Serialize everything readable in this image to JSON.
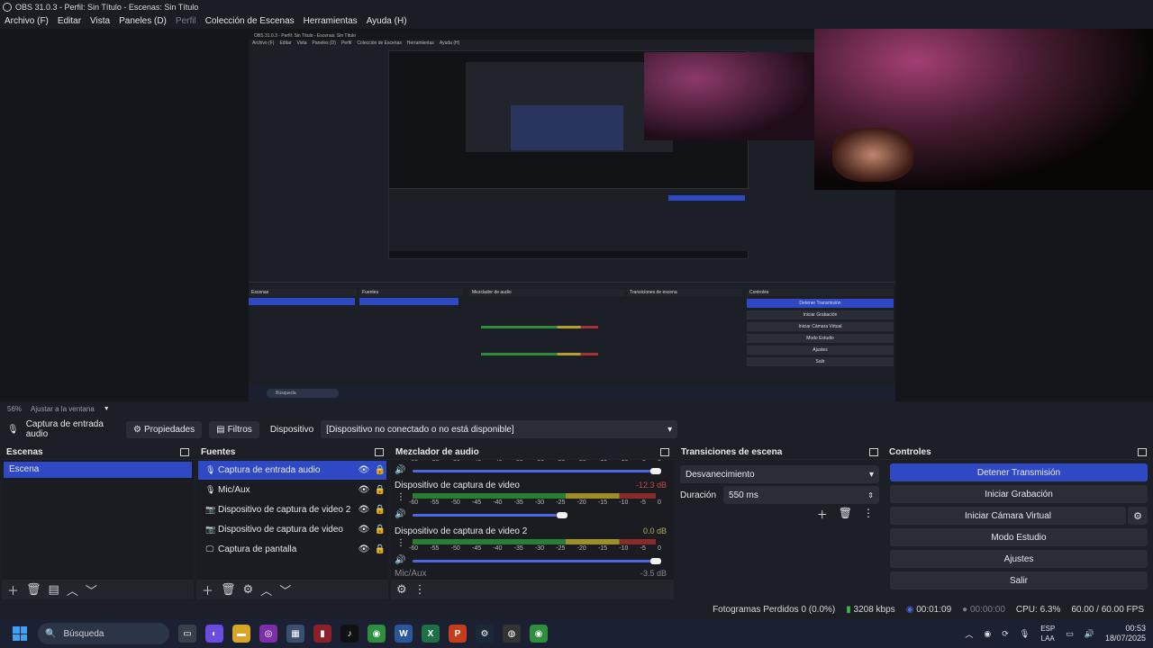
{
  "window": {
    "title": "OBS 31.0.3 - Perfil: Sin Título - Escenas: Sin Título"
  },
  "menu": [
    {
      "label": "Archivo (F)",
      "enabled": true
    },
    {
      "label": "Editar",
      "enabled": true
    },
    {
      "label": "Vista",
      "enabled": true
    },
    {
      "label": "Paneles (D)",
      "enabled": true
    },
    {
      "label": "Perfil",
      "enabled": false
    },
    {
      "label": "Colección de Escenas",
      "enabled": true
    },
    {
      "label": "Herramientas",
      "enabled": true
    },
    {
      "label": "Ayuda (H)",
      "enabled": true
    }
  ],
  "preview": {
    "zoom": "56%",
    "fit_label": "Ajustar a la ventana"
  },
  "context": {
    "source_name": "Captura de entrada audio",
    "properties_label": "Propiedades",
    "filters_label": "Filtros",
    "device_label": "Dispositivo",
    "device_value": "[Dispositivo no conectado o no está disponible]"
  },
  "scenes": {
    "title": "Escenas",
    "items": [
      {
        "label": "Escena",
        "selected": true
      }
    ]
  },
  "sources": {
    "title": "Fuentes",
    "items": [
      {
        "label": "Captura de entrada audio",
        "icon": "mic-icon",
        "selected": true
      },
      {
        "label": "Mic/Aux",
        "icon": "mic-icon",
        "selected": false
      },
      {
        "label": "Dispositivo de captura de video 2",
        "icon": "camera-icon",
        "selected": false
      },
      {
        "label": "Dispositivo de captura de video",
        "icon": "camera-icon",
        "selected": false
      },
      {
        "label": "Captura de pantalla",
        "icon": "monitor-icon",
        "selected": false
      }
    ]
  },
  "mixer": {
    "title": "Mezclador de audio",
    "scale": [
      "-60",
      "-55",
      "-50",
      "-45",
      "-40",
      "-35",
      "-30",
      "-25",
      "-20",
      "-15",
      "-10",
      "-5",
      "0"
    ],
    "tracks": [
      {
        "name": "",
        "db": "",
        "volume": 0.98
      },
      {
        "name": "Dispositivo de captura de video",
        "db": "-12.3 dB",
        "volume": 0.6
      },
      {
        "name": "Dispositivo de captura de video 2",
        "db": "0.0 dB",
        "volume": 0.98
      }
    ],
    "partial_track": {
      "name": "Mic/Aux",
      "db": "-3.5 dB"
    }
  },
  "transitions": {
    "title": "Transiciones de escena",
    "selected": "Desvanecimiento",
    "duration_label": "Duración",
    "duration_value": "550 ms"
  },
  "controls": {
    "title": "Controles",
    "stop_stream": "Detener Transmisión",
    "start_record": "Iniciar Grabación",
    "virtual_cam": "Iniciar Cámara Virtual",
    "studio_mode": "Modo Estudio",
    "settings": "Ajustes",
    "exit": "Salir"
  },
  "status": {
    "dropped": "Fotogramas Perdidos 0 (0.0%)",
    "bitrate": "3208 kbps",
    "stream_time": "00:01:09",
    "record_time": "00:00:00",
    "cpu": "CPU: 6.3%",
    "fps": "60.00 / 60.00 FPS"
  },
  "taskbar": {
    "search_placeholder": "Búsqueda",
    "lang_top": "ESP",
    "lang_bottom": "LAA",
    "time": "00:53",
    "date": "18/07/2025"
  },
  "colors": {
    "accent": "#2f49c4",
    "background": "#1d1f26",
    "panel": "#23252d"
  }
}
